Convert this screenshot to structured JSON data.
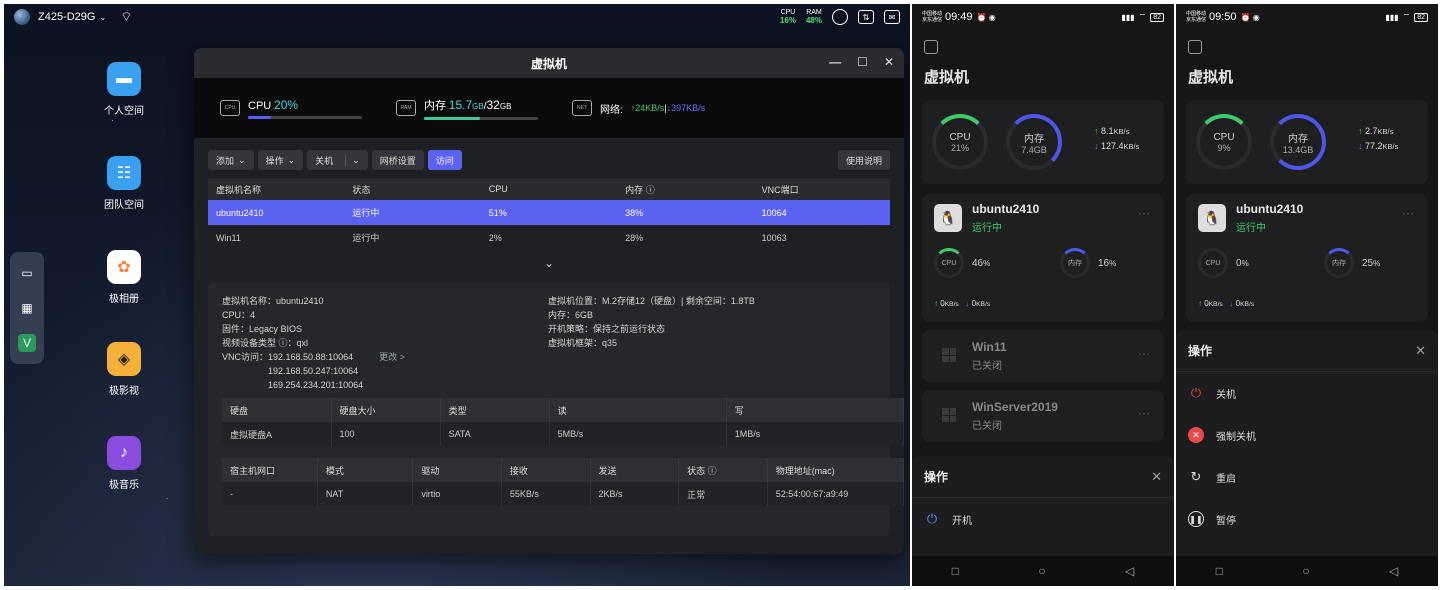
{
  "desktop": {
    "device_name": "Z425-D29G",
    "cpu_label": "CPU",
    "cpu_value": "16%",
    "ram_label": "RAM",
    "ram_value": "48%",
    "apps": [
      {
        "label": "个人空间",
        "icon": "folder-icon",
        "color": "#3aa0f0"
      },
      {
        "label": "团队空间",
        "icon": "team-folder-icon",
        "color": "#3aa0f0"
      },
      {
        "label": "极相册",
        "icon": "photos-icon",
        "color": "#ffffff"
      },
      {
        "label": "极影视",
        "icon": "video-icon",
        "color": "#f5b03a"
      },
      {
        "label": "极音乐",
        "icon": "music-icon",
        "color": "#8a4de0"
      }
    ]
  },
  "vm_window": {
    "title": "虚拟机",
    "cpu": {
      "label": "CPU",
      "value": "20%",
      "percent": 20
    },
    "mem": {
      "label": "内存",
      "used": "15.7",
      "used_unit": "GB",
      "sep": "/",
      "total": "32",
      "total_unit": "GB",
      "percent": 49
    },
    "net": {
      "label": "网络:",
      "up": "↑24KB/s",
      "sep": "|",
      "down": "↓397KB/s"
    },
    "toolbar": {
      "add": "添加",
      "ops": "操作",
      "shutdown": "关机",
      "bridge": "网桥设置",
      "visit": "访问",
      "help": "使用说明"
    },
    "table": {
      "headers": [
        "虚拟机名称",
        "状态",
        "CPU",
        "内存",
        "VNC端口"
      ],
      "rows": [
        [
          "ubuntu2410",
          "运行中",
          "51%",
          "38%",
          "10064"
        ],
        [
          "Win11",
          "运行中",
          "2%",
          "28%",
          "10063"
        ]
      ]
    },
    "detail": {
      "name": "虚拟机名称：ubuntu2410",
      "cpu": "CPU：4",
      "firmware": "固件：Legacy BIOS",
      "video": "视频设备类型",
      "video_val": "：qxl",
      "vnc_label": "VNC访问：",
      "vnc": [
        "192.168.50.88:10064",
        "192.168.50.247:10064",
        "169.254.234.201:10064"
      ],
      "vnc_more": "更改 >",
      "location": "虚拟机位置：M.2存储12（硬盘）| 剩余空间：1.8TB",
      "memory": "内存：6GB",
      "boot_policy": "开机策略：保持之前运行状态",
      "arch": "虚拟机框架：q35"
    },
    "disk_table": {
      "headers": [
        "硬盘",
        "硬盘大小",
        "类型",
        "读",
        "写"
      ],
      "rows": [
        [
          "虚拟硬盘A",
          "100",
          "SATA",
          "5MB/s",
          "1MB/s"
        ]
      ]
    },
    "net_table": {
      "headers": [
        "宿主机网口",
        "模式",
        "驱动",
        "接收",
        "发送",
        "状态",
        "物理地址(mac)"
      ],
      "rows": [
        [
          "-",
          "NAT",
          "virtio",
          "55KB/s",
          "2KB/s",
          "正常",
          "52:54:00:67:a9:49"
        ]
      ]
    }
  },
  "phone1": {
    "carrier": "中国移动\n京东通信",
    "time": "09:49",
    "battery": "82",
    "title": "虚拟机",
    "cpu": {
      "label": "CPU",
      "value": "21",
      "unit": "%"
    },
    "mem": {
      "label": "内存",
      "value": "7.4",
      "unit": "GB"
    },
    "up": "8.1",
    "down": "127.4",
    "rate_unit": "KB/s",
    "vms": [
      {
        "name": "ubuntu2410",
        "status": "运行中",
        "cpu_label": "CPU",
        "cpu": "46",
        "mem_label": "内存",
        "mem": "16",
        "up": "0",
        "down": "0"
      },
      {
        "name": "Win11",
        "status": "已关闭"
      },
      {
        "name": "WinServer2019",
        "status": "已关闭"
      }
    ],
    "sheet_title": "操作",
    "actions": [
      "开机"
    ]
  },
  "phone2": {
    "carrier": "中国移动\n京东通信",
    "time": "09:50",
    "battery": "82",
    "title": "虚拟机",
    "cpu": {
      "label": "CPU",
      "value": "9",
      "unit": "%"
    },
    "mem": {
      "label": "内存",
      "value": "13.4",
      "unit": "GB"
    },
    "up": "2.7",
    "down": "77.2",
    "rate_unit": "KB/s",
    "vm": {
      "name": "ubuntu2410",
      "status": "运行中",
      "cpu_label": "CPU",
      "cpu": "0",
      "mem_label": "内存",
      "mem": "25",
      "up": "0",
      "down": "0"
    },
    "sheet_title": "操作",
    "actions": [
      "关机",
      "强制关机",
      "重启",
      "暂停"
    ]
  },
  "colors": {
    "accent": "#5b62f0",
    "green": "#3fca6b",
    "cyan": "#4cd7e0"
  }
}
